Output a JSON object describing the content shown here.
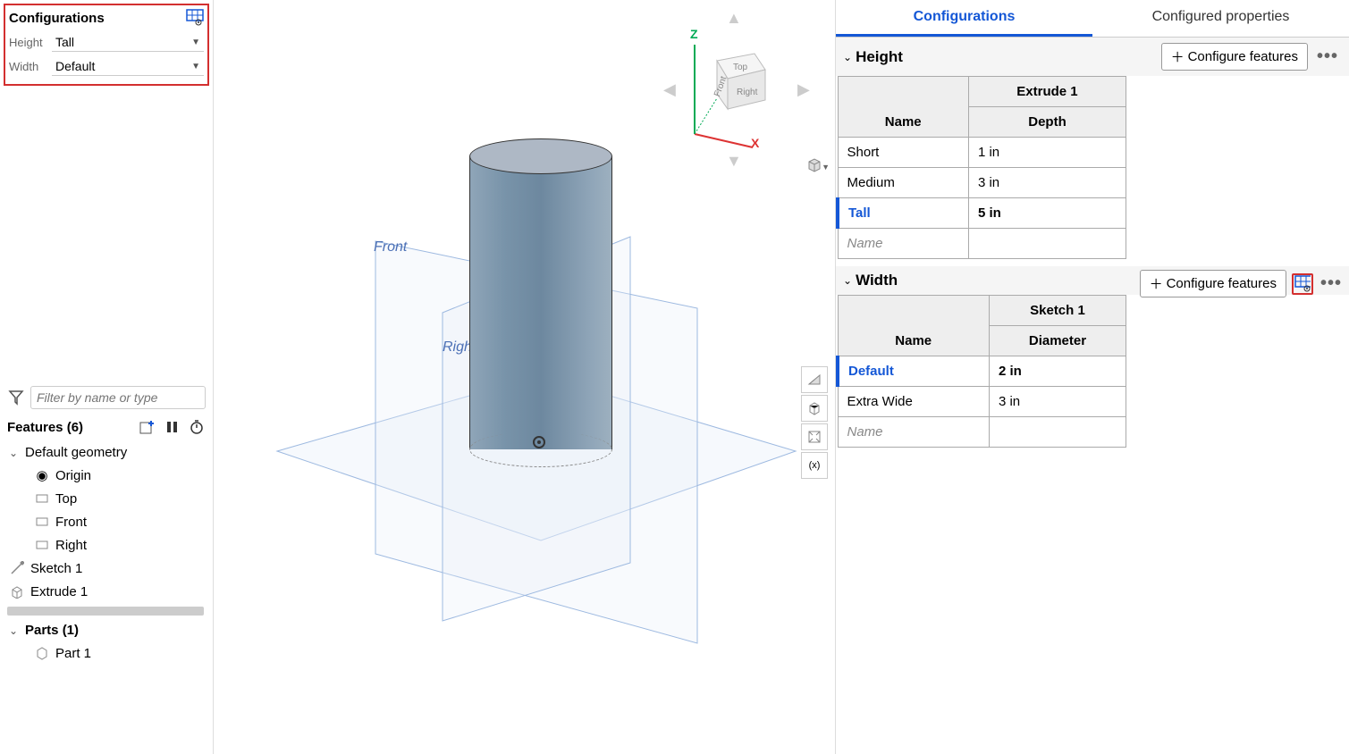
{
  "leftPanel": {
    "title": "Configurations",
    "height_label": "Height",
    "height_value": "Tall",
    "width_label": "Width",
    "width_value": "Default"
  },
  "filter": {
    "placeholder": "Filter by name or type"
  },
  "features": {
    "title": "Features (6)",
    "default_geometry": "Default geometry",
    "origin": "Origin",
    "top": "Top",
    "front": "Front",
    "right": "Right",
    "sketch1": "Sketch 1",
    "extrude1": "Extrude 1"
  },
  "parts": {
    "title": "Parts (1)",
    "part1": "Part 1"
  },
  "viewport": {
    "axis_z": "Z",
    "axis_x": "X",
    "cube_top": "Top",
    "cube_front": "Front",
    "cube_right": "Right",
    "plane_front": "Front",
    "plane_right": "Right"
  },
  "rightPanel": {
    "tabs": {
      "configurations": "Configurations",
      "properties": "Configured properties"
    },
    "configure_features_btn": "Configure features",
    "height": {
      "title": "Height",
      "col_group": "Extrude 1",
      "col_name": "Name",
      "col_value": "Depth",
      "rows": [
        {
          "name": "Short",
          "value": "1 in"
        },
        {
          "name": "Medium",
          "value": "3 in"
        },
        {
          "name": "Tall",
          "value": "5 in"
        }
      ],
      "placeholder": "Name"
    },
    "width": {
      "title": "Width",
      "col_group": "Sketch 1",
      "col_name": "Name",
      "col_value": "Diameter",
      "rows": [
        {
          "name": "Default",
          "value": "2 in"
        },
        {
          "name": "Extra Wide",
          "value": "3 in"
        }
      ],
      "placeholder": "Name"
    }
  }
}
